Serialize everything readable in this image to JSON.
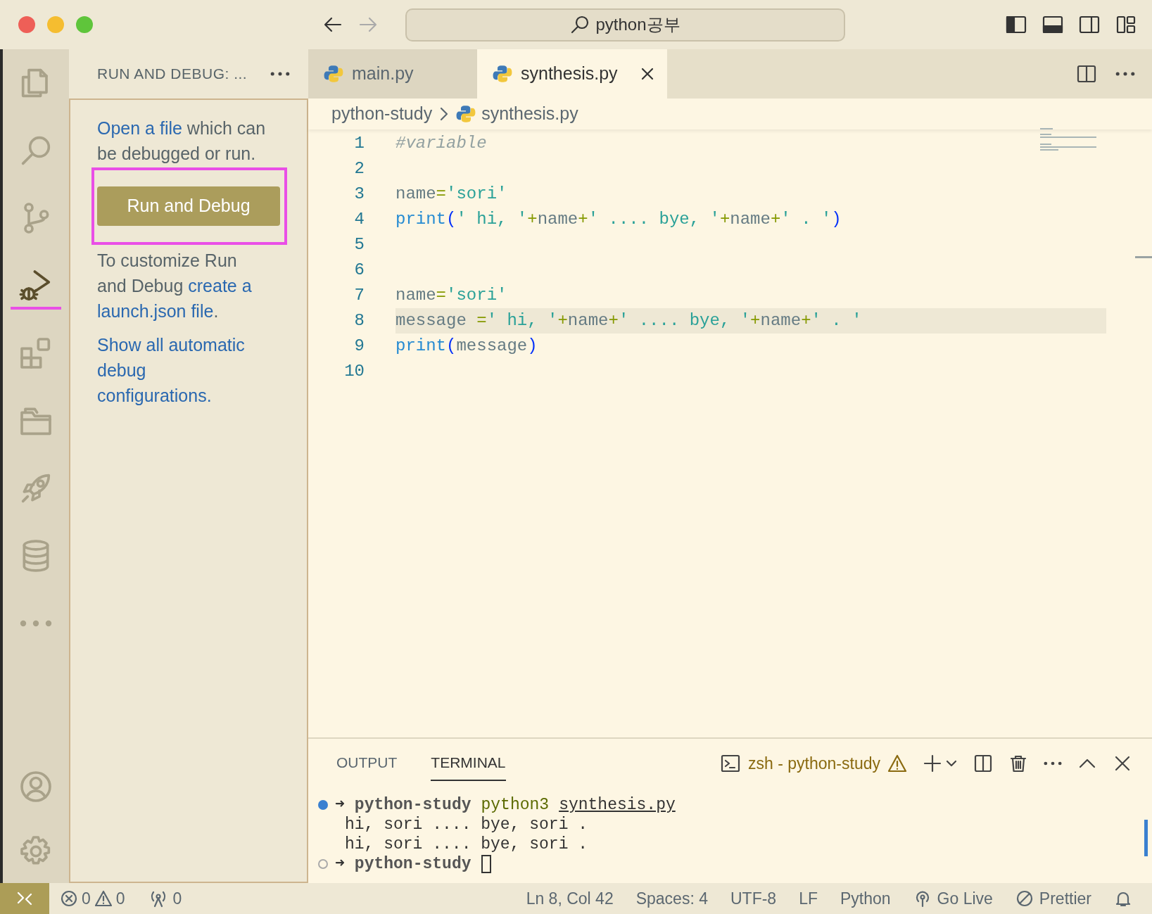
{
  "title_bar": {
    "search": "python공부"
  },
  "activity_bar": {
    "items": [
      {
        "kind": "files",
        "selected": false
      },
      {
        "kind": "search",
        "selected": false
      },
      {
        "kind": "source-control",
        "selected": false
      },
      {
        "kind": "run-debug",
        "selected": true
      },
      {
        "kind": "extensions",
        "selected": false
      },
      {
        "kind": "folder",
        "selected": false
      },
      {
        "kind": "rocket",
        "selected": false
      },
      {
        "kind": "database",
        "selected": false
      },
      {
        "kind": "more",
        "selected": false
      }
    ],
    "bottom_items": [
      {
        "kind": "account"
      },
      {
        "kind": "settings"
      }
    ]
  },
  "sidebar": {
    "title": "RUN AND DEBUG: ...",
    "intro": [
      {
        "text": "Open a file",
        "link": true
      },
      {
        "text": " which can be debugged or run.",
        "link": false
      }
    ],
    "button": "Run and Debug",
    "customize": [
      {
        "text": "To customize Run and Debug ",
        "link": false
      },
      {
        "text": "create a ",
        "link": true
      },
      {
        "text": "launch.json file",
        "link": true
      },
      {
        "text": ".",
        "link": false
      }
    ],
    "show_all": "Show all automatic debug configurations."
  },
  "editor": {
    "tabs": [
      {
        "label": "main.py",
        "selected": false
      },
      {
        "label": "synthesis.py",
        "selected": true
      }
    ],
    "breadcrumb": [
      {
        "kind": "folder",
        "label": "python-study"
      },
      {
        "kind": "file",
        "label": "synthesis.py"
      }
    ],
    "lines": [
      {
        "number": "1",
        "tokens": [
          {
            "kind": "comment",
            "text": "#variable"
          }
        ],
        "highlighted": false
      },
      {
        "number": "2",
        "highlighted": false
      },
      {
        "number": "3",
        "tokens": [
          {
            "kind": "plain",
            "text": "name"
          },
          {
            "kind": "op",
            "text": "="
          },
          {
            "kind": "string",
            "text": "'sori'"
          }
        ],
        "highlighted": false
      },
      {
        "number": "4",
        "tokens": [
          {
            "kind": "func",
            "text": "print"
          },
          {
            "kind": "bracket",
            "text": "("
          },
          {
            "kind": "string",
            "text": "' hi, '"
          },
          {
            "kind": "op",
            "text": "+"
          },
          {
            "kind": "plain",
            "text": "name"
          },
          {
            "kind": "op",
            "text": "+"
          },
          {
            "kind": "string",
            "text": "' .... bye, '"
          },
          {
            "kind": "op",
            "text": "+"
          },
          {
            "kind": "plain",
            "text": "name"
          },
          {
            "kind": "op",
            "text": "+"
          },
          {
            "kind": "string",
            "text": "' . '"
          },
          {
            "kind": "bracket",
            "text": ")"
          }
        ],
        "highlighted": false
      },
      {
        "number": "5",
        "highlighted": false
      },
      {
        "number": "6",
        "highlighted": false
      },
      {
        "number": "7",
        "tokens": [
          {
            "kind": "plain",
            "text": "name"
          },
          {
            "kind": "op",
            "text": "="
          },
          {
            "kind": "string",
            "text": "'sori'"
          }
        ],
        "highlighted": false
      },
      {
        "number": "8",
        "tokens": [
          {
            "kind": "plain",
            "text": "message "
          },
          {
            "kind": "op",
            "text": "="
          },
          {
            "kind": "string",
            "text": "' hi, '"
          },
          {
            "kind": "op",
            "text": "+"
          },
          {
            "kind": "plain",
            "text": "name"
          },
          {
            "kind": "op",
            "text": "+"
          },
          {
            "kind": "string",
            "text": "' .... bye, '"
          },
          {
            "kind": "op",
            "text": "+"
          },
          {
            "kind": "plain",
            "text": "name"
          },
          {
            "kind": "op",
            "text": "+"
          },
          {
            "kind": "string",
            "text": "' . '"
          }
        ],
        "highlighted": true
      },
      {
        "number": "9",
        "tokens": [
          {
            "kind": "func",
            "text": "print"
          },
          {
            "kind": "bracket",
            "text": "("
          },
          {
            "kind": "plain",
            "text": "message"
          },
          {
            "kind": "bracket",
            "text": ")"
          }
        ],
        "highlighted": false
      },
      {
        "number": "10",
        "highlighted": false
      }
    ]
  },
  "panel": {
    "tabs": [
      {
        "label": "OUTPUT",
        "selected": false
      },
      {
        "label": "TERMINAL",
        "selected": true
      }
    ],
    "terminal_name": "zsh - python-study",
    "lines": [
      {
        "kind": "prompt",
        "filled": true,
        "arrow": "➜",
        "dir": "python-study",
        "command": "python3",
        "arg": "synthesis.py",
        "cursor": false
      },
      {
        "kind": "output",
        "text": "hi, sori .... bye, sori ."
      },
      {
        "kind": "output",
        "text": "hi, sori .... bye, sori ."
      },
      {
        "kind": "prompt",
        "filled": false,
        "arrow": "➜",
        "dir": "python-study",
        "cursor": true
      }
    ]
  },
  "status_bar": {
    "left": [
      {
        "kind": "remote"
      },
      {
        "kind": "problems",
        "errors": "0",
        "warnings": "0"
      },
      {
        "kind": "ports",
        "text": "0"
      }
    ],
    "right": [
      {
        "kind": "text",
        "text": "Ln 8, Col 42"
      },
      {
        "kind": "text",
        "text": "Spaces: 4"
      },
      {
        "kind": "text",
        "text": "UTF-8"
      },
      {
        "kind": "text",
        "text": "LF"
      },
      {
        "kind": "text",
        "text": "Python"
      },
      {
        "kind": "golive",
        "text": "Go Live"
      },
      {
        "kind": "prettier",
        "text": "Prettier"
      },
      {
        "kind": "bell"
      }
    ]
  }
}
